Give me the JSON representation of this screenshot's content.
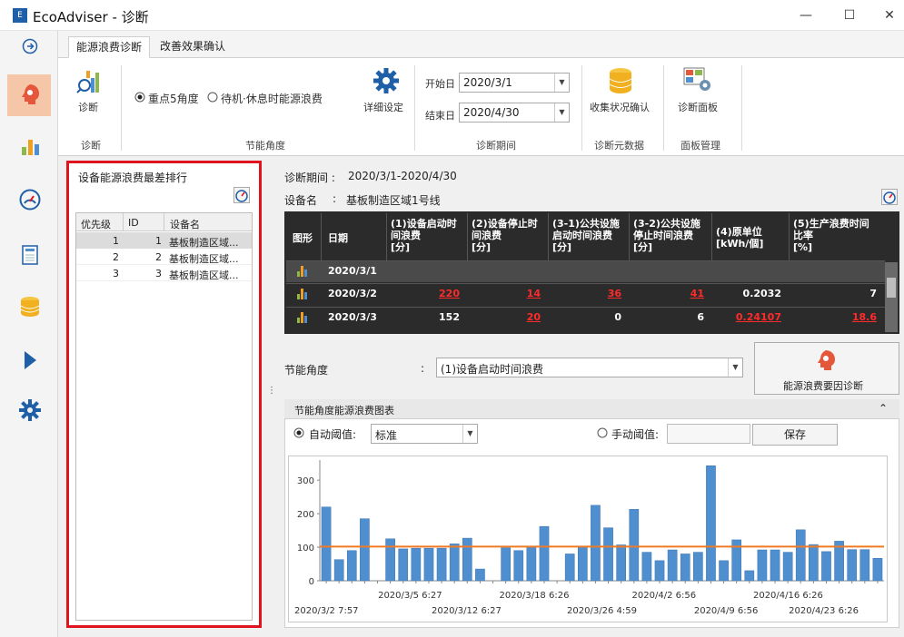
{
  "window": {
    "title": "EcoAdviser - 诊断",
    "minimize": "—",
    "maximize": "☐",
    "close": "✕"
  },
  "tabs": [
    "能源浪费诊断",
    "改善效果确认"
  ],
  "ribbon": {
    "diagnose_label": "诊断",
    "radio_selected": "重点5角度",
    "radio_other": "待机·休息时能源浪费",
    "detail_label": "详细设定",
    "start_label": "开始日",
    "start_value": "2020/3/1",
    "end_label": "结束日",
    "end_value": "2020/4/30",
    "collect_label": "收集状况确认",
    "panel_label": "诊断面板",
    "groups": [
      "诊断",
      "节能角度",
      "诊断期间",
      "诊断元数据",
      "面板管理"
    ]
  },
  "ranking": {
    "title": "设备能源浪费最差排行",
    "columns": [
      "优先级",
      "ID",
      "设备名"
    ],
    "rows": [
      {
        "priority": "1",
        "id": "1",
        "name": "基板制造区域..."
      },
      {
        "priority": "2",
        "id": "2",
        "name": "基板制造区域..."
      },
      {
        "priority": "3",
        "id": "3",
        "name": "基板制造区域..."
      }
    ]
  },
  "info": {
    "period_label": "诊断期间 :",
    "period_value": "2020/3/1-2020/4/30",
    "device_label": "设备名",
    "device_sep": ":",
    "device_value": "基板制造区域1号线"
  },
  "grid": {
    "headers": [
      "图形",
      "日期",
      "(1)设备启动时间浪费[分]",
      "(2)设备停止时间浪费[分]",
      "(3-1)公共设施启动时间浪费[分]",
      "(3-2)公共设施停止时间浪费[分]",
      "(4)原单位[kWh/個]",
      "(5)生产浪费时间比率[%]"
    ],
    "header_lines": [
      [
        "(1)设备启动时",
        "间浪费",
        "[分]"
      ],
      [
        "(2)设备停止时",
        "间浪费",
        "[分]"
      ],
      [
        "(3-1)公共设施",
        "启动时间浪费",
        "[分]"
      ],
      [
        "(3-2)公共设施",
        "停止时间浪费",
        "[分]"
      ],
      [
        "(4)原单位",
        "[kWh/個]"
      ],
      [
        "(5)生产浪费时间",
        "比率",
        "[%]"
      ]
    ],
    "rows": [
      {
        "date": "2020/3/1",
        "v": [
          "",
          "",
          "",
          "",
          "",
          ""
        ]
      },
      {
        "date": "2020/3/2",
        "v": [
          "220",
          "14",
          "36",
          "41",
          "0.2032",
          "7"
        ]
      },
      {
        "date": "2020/3/3",
        "v": [
          "152",
          "20",
          "0",
          "6",
          "0.24107",
          "18.6"
        ]
      }
    ]
  },
  "angle": {
    "label": "节能角度",
    "sep": ":",
    "value": "(1)设备启动时间浪费",
    "cause_button": "能源浪费要因诊断"
  },
  "chart_panel": {
    "title": "节能角度能源浪费图表",
    "auto_label": "自动阈值:",
    "auto_value": "标准",
    "manual_label": "手动阈值:",
    "save_button": "保存"
  },
  "chart_data": {
    "type": "bar",
    "yticks": [
      0,
      100,
      200,
      300
    ],
    "ylim": [
      0,
      360
    ],
    "threshold": 102,
    "values": [
      220,
      63,
      90,
      185,
      0,
      125,
      95,
      97,
      97,
      97,
      110,
      127,
      35,
      0,
      98,
      90,
      103,
      162,
      0,
      80,
      100,
      225,
      158,
      107,
      213,
      85,
      60,
      92,
      80,
      85,
      343,
      60,
      122,
      30,
      92,
      92,
      85,
      152,
      108,
      87,
      118,
      93,
      93,
      67
    ],
    "xlabels_top": [
      "2020/3/5 6:27",
      "2020/3/18 6:26",
      "2020/4/2 6:56",
      "2020/4/16 6:26"
    ],
    "xlabels_bottom": [
      "2020/3/2 7:57",
      "2020/3/12 6:27",
      "2020/3/26 4:59",
      "2020/4/9 6:56",
      "2020/4/23 6:26"
    ],
    "bar_color": "#4f8fd0",
    "threshold_color": "#f07a24"
  }
}
